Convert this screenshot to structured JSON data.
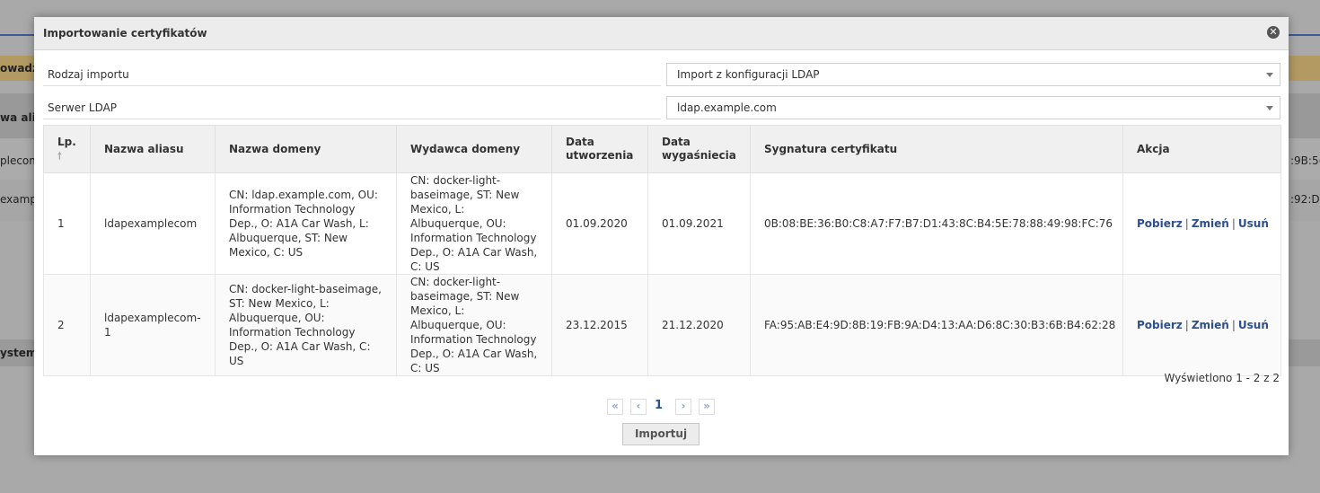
{
  "background": {
    "left_texts": [
      "owadz",
      "wa alia",
      "plecom",
      "examp",
      "ystem"
    ],
    "right_texts": [
      ":9B:5(",
      ":92:D"
    ]
  },
  "dialog": {
    "title": "Importowanie certyfikatów",
    "close_icon": "close-icon",
    "fields": [
      {
        "label": "Rodzaj importu",
        "value": "Import z konfiguracji LDAP"
      },
      {
        "label": "Serwer LDAP",
        "value": "ldap.example.com"
      }
    ],
    "table": {
      "headers": [
        "Lp.",
        "Nazwa aliasu",
        "Nazwa domeny",
        "Wydawca domeny",
        "Data utworzenia",
        "Data wygaśniecia",
        "Sygnatura certyfikatu",
        "Akcja"
      ],
      "rows": [
        {
          "lp": "1",
          "alias": "ldapexamplecom",
          "domain": "CN: ldap.example.com, OU: Information Technology Dep., O: A1A Car Wash, L: Albuquerque, ST: New Mexico, C: US",
          "issuer": "CN: docker-light-baseimage, ST: New Mexico, L: Albuquerque, OU: Information Technology Dep., O: A1A Car Wash, C: US",
          "created": "01.09.2020",
          "expires": "01.09.2021",
          "signature": "0B:08:BE:36:B0:C8:A7:F7:B7:D1:43:8C:B4:5E:78:88:49:98:FC:76"
        },
        {
          "lp": "2",
          "alias": "ldapexamplecom-1",
          "domain": "CN: docker-light-baseimage, ST: New Mexico, L: Albuquerque, OU: Information Technology Dep., O: A1A Car Wash, C: US",
          "issuer": "CN: docker-light-baseimage, ST: New Mexico, L: Albuquerque, OU: Information Technology Dep., O: A1A Car Wash, C: US",
          "created": "23.12.2015",
          "expires": "21.12.2020",
          "signature": "FA:95:AB:E4:9D:8B:19:FB:9A:D4:13:AA:D6:8C:30:B3:6B:B4:62:28"
        }
      ],
      "actions": {
        "download": "Pobierz",
        "change": "Zmień",
        "delete": "Usuń",
        "separator": "|"
      }
    },
    "summary": "Wyświetlono 1 - 2 z 2",
    "pager": {
      "first": "«",
      "prev": "‹",
      "page": "1",
      "next": "›",
      "last": "»"
    },
    "import_button": "Importuj"
  },
  "colors": {
    "link": "#2d4f8f",
    "header_bg": "#ececec",
    "overlay": "#a9a9a9"
  }
}
